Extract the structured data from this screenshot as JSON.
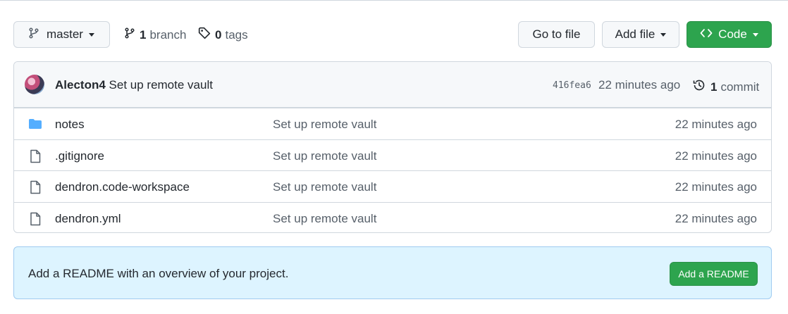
{
  "toolbar": {
    "branch_selector": {
      "label": "master",
      "icon": "git-branch-icon"
    },
    "branches": {
      "count": "1",
      "label": "branch",
      "icon": "git-branch-icon"
    },
    "tags": {
      "count": "0",
      "label": "tags",
      "icon": "tag-icon"
    },
    "go_to_file_label": "Go to file",
    "add_file_label": "Add file",
    "code_label": "Code",
    "code_icon": "code-icon"
  },
  "latest_commit": {
    "author": "Alecton4",
    "message": "Set up remote vault",
    "sha": "416fea6",
    "time": "22 minutes ago",
    "commit_count": "1",
    "commit_label": "commit",
    "history_icon": "history-icon"
  },
  "files": [
    {
      "name": "notes",
      "type": "directory",
      "icon": "folder-icon",
      "message": "Set up remote vault",
      "time": "22 minutes ago"
    },
    {
      "name": ".gitignore",
      "type": "file",
      "icon": "file-icon",
      "message": "Set up remote vault",
      "time": "22 minutes ago"
    },
    {
      "name": "dendron.code-workspace",
      "type": "file",
      "icon": "file-icon",
      "message": "Set up remote vault",
      "time": "22 minutes ago"
    },
    {
      "name": "dendron.yml",
      "type": "file",
      "icon": "file-icon",
      "message": "Set up remote vault",
      "time": "22 minutes ago"
    }
  ],
  "readme_banner": {
    "text": "Add a README with an overview of your project.",
    "button_label": "Add a README"
  },
  "colors": {
    "primary_green": "#2da44e",
    "folder_blue": "#54aeff",
    "banner_bg": "#ddf4ff",
    "border": "#d0d7de",
    "muted_text": "#57606a"
  }
}
